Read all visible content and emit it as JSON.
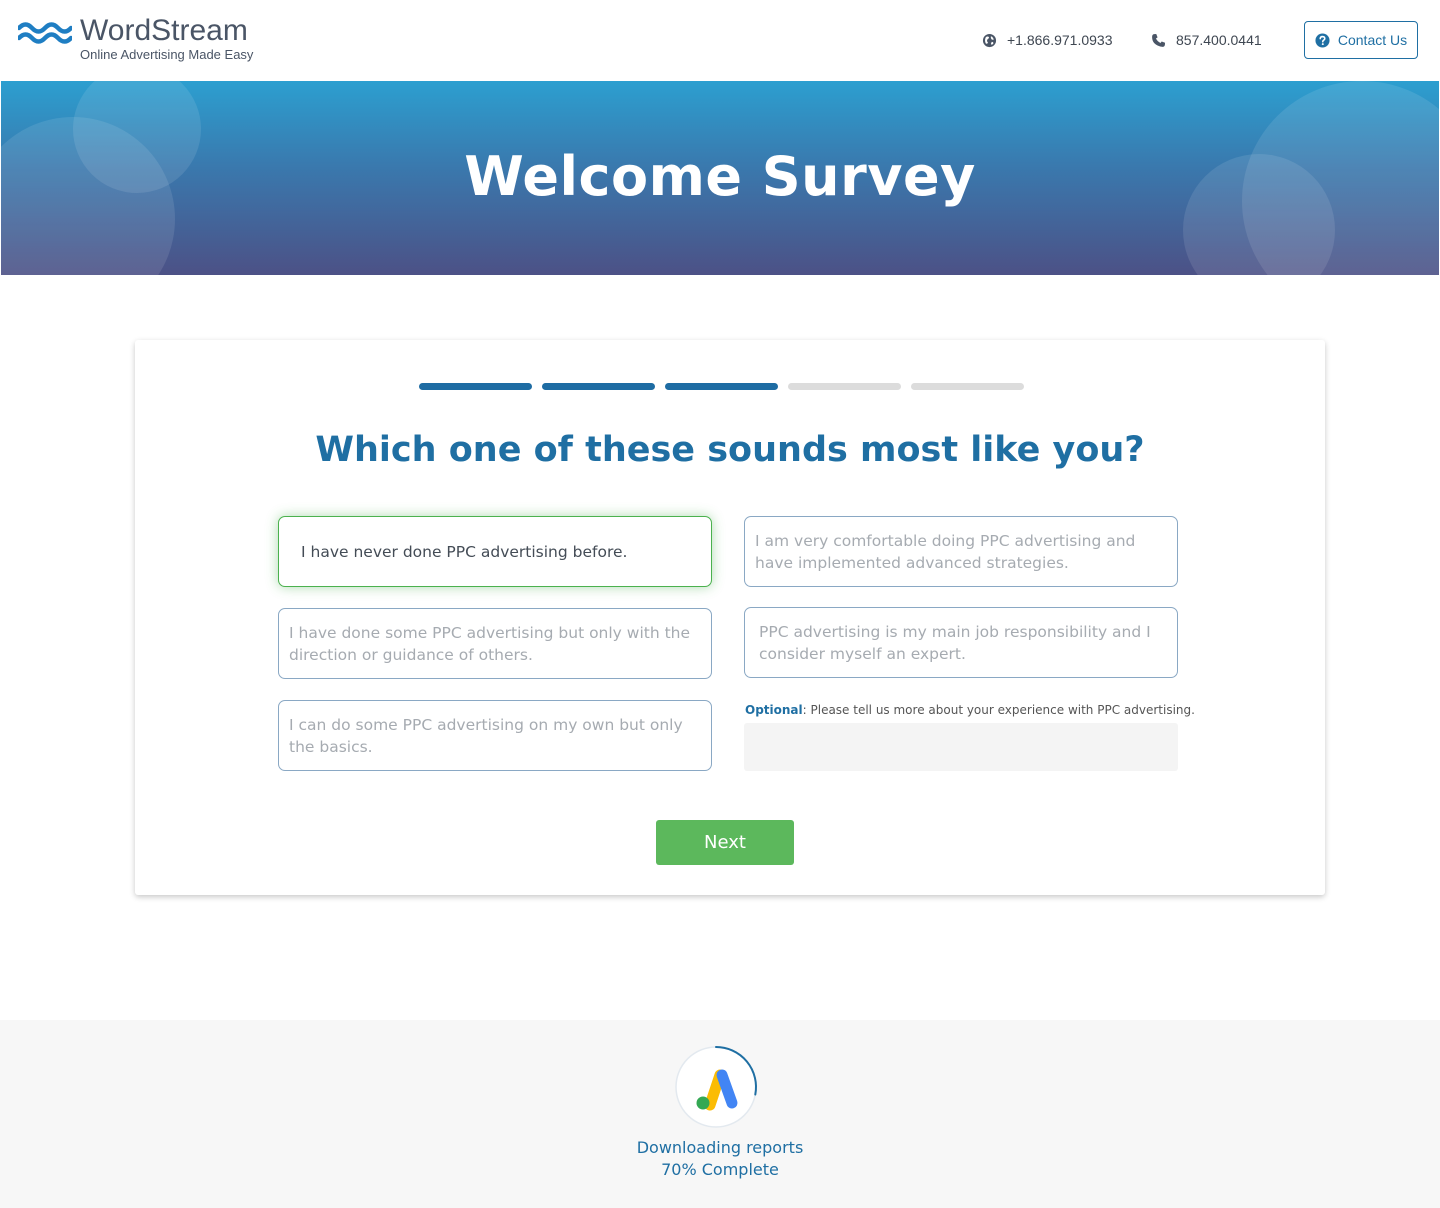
{
  "header": {
    "logo_name": "WordStream",
    "logo_tagline": "Online Advertising Made Easy",
    "phone_intl": "+1.866.971.0933",
    "phone_local": "857.400.0441",
    "contact_label": "Contact Us"
  },
  "hero": {
    "title": "Welcome Survey"
  },
  "survey": {
    "progress": {
      "completed_steps": 3,
      "total_steps": 5
    },
    "question": "Which one of these sounds most like you?",
    "options": [
      {
        "label": "I have never done PPC advertising before.",
        "selected": true
      },
      {
        "label": "I have done some PPC advertising but only with the direction or guidance of others.",
        "selected": false
      },
      {
        "label": "I can do some PPC advertising on my own but only the basics.",
        "selected": false
      },
      {
        "label": "I am very comfortable doing PPC advertising and have implemented advanced strategies.",
        "selected": false
      },
      {
        "label": "PPC advertising is my main job responsibility and I consider myself an expert.",
        "selected": false
      }
    ],
    "optional_prefix": "Optional",
    "optional_text": ": Please tell us more about your experience with PPC advertising.",
    "optional_value": "",
    "next_label": "Next"
  },
  "footer": {
    "status_line": "Downloading reports",
    "progress_text": "70% Complete",
    "progress_fraction": 0.7
  },
  "colors": {
    "brand_blue": "#1f6fa3",
    "progress_done": "#1e6ca3",
    "progress_todo": "#dcdcdc",
    "selected_green": "#4bb14e",
    "next_green": "#5cb85c"
  },
  "icons": {
    "logo": "waves-logo-icon",
    "phone_intl": "globe-icon",
    "phone_local": "phone-icon",
    "contact": "question-circle-icon",
    "loader": "google-ads-icon"
  }
}
